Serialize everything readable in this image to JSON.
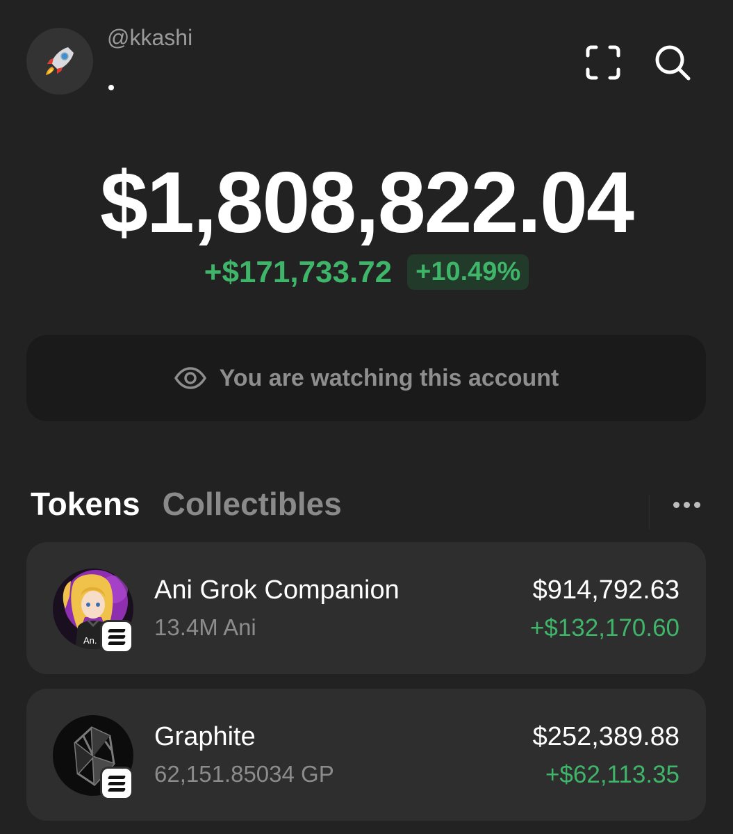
{
  "header": {
    "username": "@kkashi",
    "avatar_icon": "rocket-icon",
    "scan_icon": "scan-icon",
    "search_icon": "search-icon"
  },
  "balance": {
    "total": "$1,808,822.04",
    "change_amount": "+$171,733.72",
    "change_percent": "+10.49%",
    "positive_color": "#3fb56a"
  },
  "watch_banner": {
    "icon": "eye-icon",
    "text": "You are watching this account"
  },
  "tabs": {
    "items": [
      {
        "label": "Tokens",
        "active": true
      },
      {
        "label": "Collectibles",
        "active": false
      }
    ],
    "more_icon": "more-horizontal-icon"
  },
  "tokens": [
    {
      "name": "Ani Grok Companion",
      "quantity": "13.4M Ani",
      "value": "$914,792.63",
      "change": "+$132,170.60",
      "logo_label": "An.",
      "chain_icon": "solana-icon"
    },
    {
      "name": "Graphite",
      "quantity": "62,151.85034 GP",
      "value": "$252,389.88",
      "change": "+$62,113.35",
      "chain_icon": "solana-icon"
    }
  ]
}
